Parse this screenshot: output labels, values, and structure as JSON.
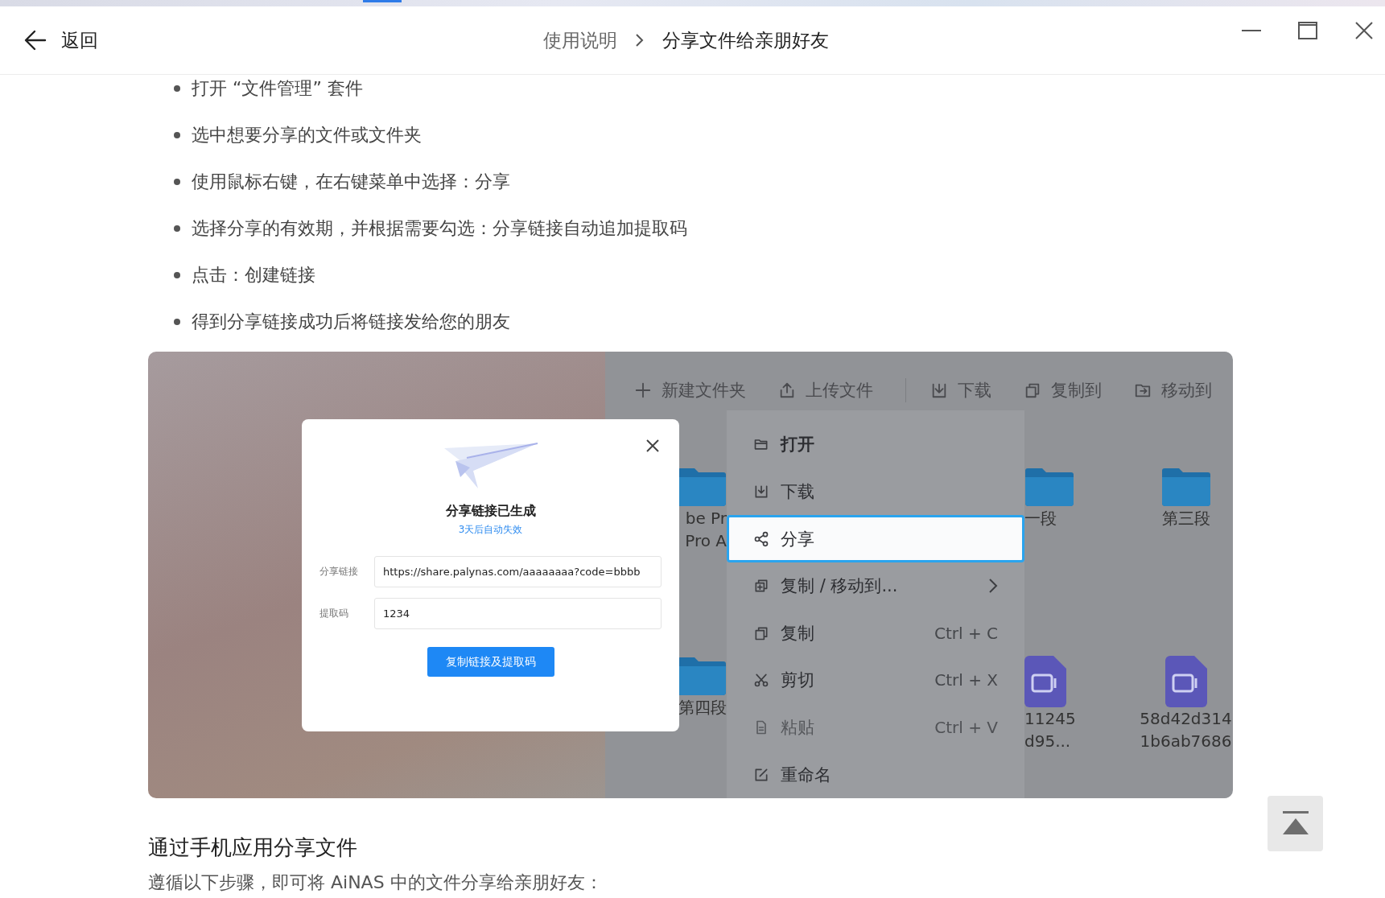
{
  "header": {
    "back_label": "返回",
    "breadcrumb": [
      {
        "label": "使用说明",
        "current": false
      },
      {
        "label": "分享文件给亲朋好友",
        "current": true
      }
    ]
  },
  "steps": [
    "打开 “文件管理” 套件",
    "选中想要分享的文件或文件夹",
    "使用鼠标右键，在右键菜单中选择：分享",
    "选择分享的有效期，并根据需要勾选：分享链接自动追加提取码",
    "点击：创建链接",
    "得到分享链接成功后将链接发给您的朋友"
  ],
  "screenshot": {
    "toolbar": [
      {
        "kind": "new-folder",
        "label": "新建文件夹",
        "separated": false
      },
      {
        "kind": "upload",
        "label": "上传文件",
        "separated": false
      },
      {
        "kind": "download",
        "label": "下载",
        "separated": true
      },
      {
        "kind": "copy",
        "label": "复制到",
        "separated": false
      },
      {
        "kind": "move",
        "label": "移动到",
        "separated": false
      }
    ],
    "files": [
      {
        "kind": "folder",
        "lines": [
          "be Pr",
          "Pro A"
        ]
      },
      {
        "kind": "folder",
        "lines": [
          "一段"
        ]
      },
      {
        "kind": "folder",
        "lines": [
          "第三段"
        ]
      },
      {
        "kind": "folder",
        "lines": [
          "第四段"
        ]
      },
      {
        "kind": "video",
        "lines": [
          "11245",
          "d95..."
        ]
      },
      {
        "kind": "video",
        "lines": [
          "58d42d314",
          "1b6ab7686"
        ]
      }
    ],
    "context_menu": [
      {
        "kind": "open",
        "label": "打开",
        "emphasized": true,
        "selected": false,
        "disabled": false,
        "submenu": false
      },
      {
        "kind": "download",
        "label": "下载",
        "emphasized": false,
        "selected": false,
        "disabled": false,
        "submenu": false
      },
      {
        "kind": "share",
        "label": "分享",
        "emphasized": false,
        "selected": true,
        "disabled": false,
        "submenu": false
      },
      {
        "kind": "copy-move",
        "label": "复制 / 移动到...",
        "emphasized": false,
        "selected": false,
        "disabled": false,
        "submenu": true
      },
      {
        "kind": "copy",
        "label": "复制",
        "shortcut": "Ctrl + C",
        "emphasized": false,
        "selected": false,
        "disabled": false,
        "submenu": false
      },
      {
        "kind": "cut",
        "label": "剪切",
        "shortcut": "Ctrl + X",
        "emphasized": false,
        "selected": false,
        "disabled": false,
        "submenu": false
      },
      {
        "kind": "paste",
        "label": "粘贴",
        "shortcut": "Ctrl + V",
        "emphasized": false,
        "selected": false,
        "disabled": true,
        "submenu": false
      },
      {
        "kind": "rename",
        "label": "重命名",
        "emphasized": false,
        "selected": false,
        "disabled": false,
        "submenu": false
      }
    ],
    "dialog": {
      "title": "分享链接已生成",
      "note": "3天后自动失效",
      "fields": [
        {
          "label": "分享链接",
          "value": "https://share.palynas.com/aaaaaaaa?code=bbbb"
        },
        {
          "label": "提取码",
          "value": "1234"
        }
      ],
      "button": "复制链接及提取码"
    }
  },
  "section_heading": "通过手机应用分享文件",
  "intro": "遵循以下步骤，即可将 AiNAS 中的文件分享给亲朋好友："
}
